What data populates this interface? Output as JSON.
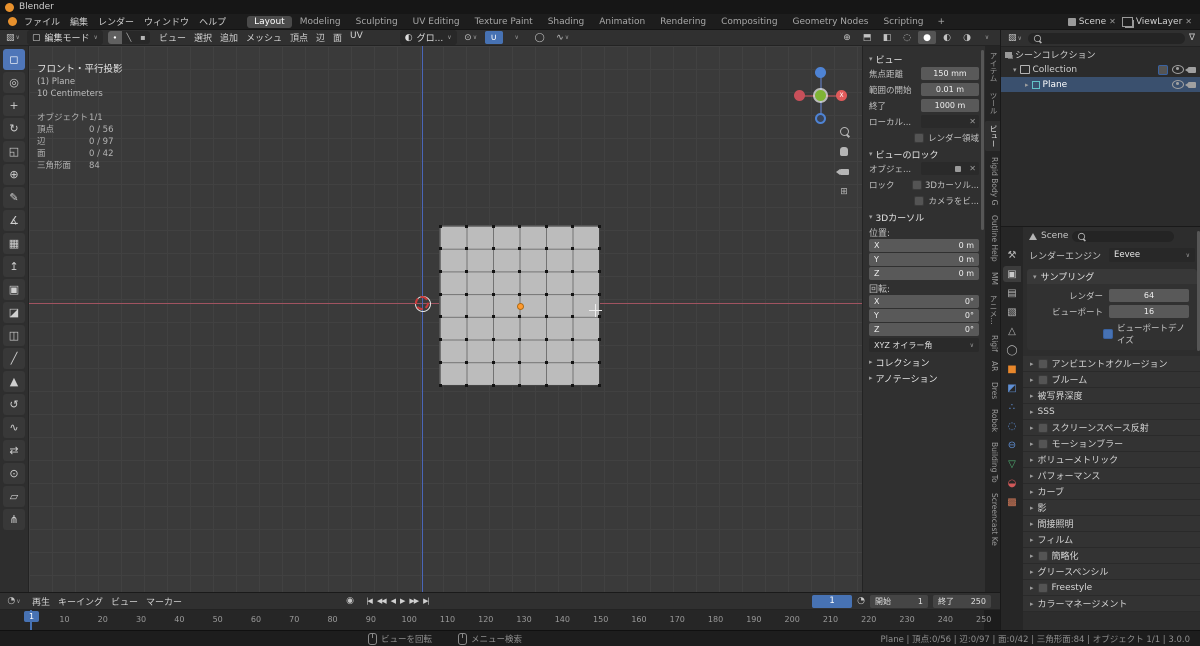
{
  "app": {
    "title": "Blender"
  },
  "colors": {
    "accent": "#4772b3",
    "object_orange": "#e8872b",
    "axis_x": "#a05360",
    "axis_z": "#4a66b8",
    "plane_fill": "#bcbcbc"
  },
  "icons": {
    "expanded": "▾",
    "collapsed": "▸",
    "dropdown": "∨",
    "close": "✕",
    "funnel": "∇",
    "grid": "⊞",
    "check": "✓",
    "globe": "◐",
    "pivot": "⊙",
    "magnet": "∪",
    "proportional": "◯",
    "falloff": "∿",
    "record": "◉",
    "clock": "◔",
    "editor_viewport": "▧",
    "editor_timeline": "◔",
    "edit_mode": "▢",
    "vertex_mode": "∙",
    "edge_mode": "╲",
    "face_mode": "▪",
    "ball_wire": "◌",
    "ball_solid": "●",
    "ball_material": "◐",
    "ball_rendered": "◑",
    "xray": "◧",
    "overlays": "⬒",
    "gizmos": "⊕"
  },
  "topbar": {
    "menus": [
      "ファイル",
      "編集",
      "レンダー",
      "ウィンドウ",
      "ヘルプ"
    ],
    "workspaces": [
      "Layout",
      "Modeling",
      "Sculpting",
      "UV Editing",
      "Texture Paint",
      "Shading",
      "Animation",
      "Rendering",
      "Compositing",
      "Geometry Nodes",
      "Scripting"
    ],
    "active_workspace": "Layout",
    "add_workspace_label": "+",
    "scene_label": "Scene",
    "view_layer_label": "ViewLayer"
  },
  "viewport_header": {
    "mode_label": "編集モード",
    "menus": [
      "ビュー",
      "選択",
      "追加",
      "メッシュ",
      "頂点",
      "辺",
      "面",
      "UV"
    ],
    "orientation_label": "グロ..."
  },
  "tools": [
    {
      "name": "select-box",
      "glyph": "◻",
      "active": true
    },
    {
      "name": "cursor",
      "glyph": "◎"
    },
    {
      "name": "move",
      "glyph": "+"
    },
    {
      "name": "rotate",
      "glyph": "↻"
    },
    {
      "name": "scale",
      "glyph": "◱"
    },
    {
      "name": "transform",
      "glyph": "⊕"
    },
    {
      "name": "annotate",
      "glyph": "✎"
    },
    {
      "name": "measure",
      "glyph": "∡"
    },
    {
      "name": "add-cube",
      "glyph": "▦"
    },
    {
      "name": "extrude",
      "glyph": "↥"
    },
    {
      "name": "inset-faces",
      "glyph": "▣"
    },
    {
      "name": "bevel",
      "glyph": "◪"
    },
    {
      "name": "loop-cut",
      "glyph": "◫"
    },
    {
      "name": "knife",
      "glyph": "╱"
    },
    {
      "name": "poly-build",
      "glyph": "▲"
    },
    {
      "name": "spin",
      "glyph": "↺"
    },
    {
      "name": "smooth",
      "glyph": "∿"
    },
    {
      "name": "edge-slide",
      "glyph": "⇄"
    },
    {
      "name": "shrink-fatten",
      "glyph": "⊙"
    },
    {
      "name": "shear",
      "glyph": "▱"
    },
    {
      "name": "rip-region",
      "glyph": "⋔"
    }
  ],
  "viewport": {
    "view_label": "フロント・平行投影",
    "object_label": "(1) Plane",
    "scale_label": "10 Centimeters",
    "stats": [
      {
        "label": "オブジェクト",
        "value": "1/1"
      },
      {
        "label": "頂点",
        "value": "0 / 56"
      },
      {
        "label": "辺",
        "value": "0 / 97"
      },
      {
        "label": "面",
        "value": "0 / 42"
      },
      {
        "label": "三角形面",
        "value": "84"
      }
    ],
    "gizmo_x_label": "X",
    "grid": {
      "cols": 6,
      "rows": 7
    }
  },
  "n_panel": {
    "tabs": [
      {
        "label": "アイテム"
      },
      {
        "label": "ツール"
      },
      {
        "label": "ビュー",
        "active": true
      },
      {
        "label": "Rigid Body G"
      },
      {
        "label": "Outline Help"
      },
      {
        "label": "MM"
      },
      {
        "label": "アニメ..."
      },
      {
        "label": "Rigif"
      },
      {
        "label": "AR"
      },
      {
        "label": "Dres"
      },
      {
        "label": "Robok"
      },
      {
        "label": "Building To"
      },
      {
        "label": "Screencast Ke"
      }
    ],
    "view": {
      "title": "ビュー",
      "focal_label": "焦点距離",
      "focal_value": "150 mm",
      "clip_start_label": "範囲の開始",
      "clip_start_value": "0.01 m",
      "clip_end_label": "終了",
      "clip_end_value": "1000 m",
      "local_camera_label": "ローカル...",
      "render_region_label": "レンダー領域"
    },
    "view_lock": {
      "title": "ビューのロック",
      "object_label": "オブジェ...",
      "lock_label": "ロック",
      "cursor_label": "3Dカーソル...",
      "camera_label": "カメラをビ..."
    },
    "cursor": {
      "title": "3Dカーソル",
      "location_label": "位置:",
      "location": [
        {
          "axis": "X",
          "value": "0 m"
        },
        {
          "axis": "Y",
          "value": "0 m"
        },
        {
          "axis": "Z",
          "value": "0 m"
        }
      ],
      "rotation_label": "回転:",
      "rotation": [
        {
          "axis": "X",
          "value": "0°"
        },
        {
          "axis": "Y",
          "value": "0°"
        },
        {
          "axis": "Z",
          "value": "0°"
        }
      ],
      "rotation_mode": "XYZ オイラー角"
    },
    "collections_title": "コレクション",
    "annotations_title": "アノテーション"
  },
  "outliner": {
    "rows": {
      "scene_collection": "シーンコレクション",
      "collection": "Collection",
      "object": "Plane"
    }
  },
  "properties": {
    "tabs": [
      {
        "name": "tool",
        "glyph": "⚒",
        "color": "#b8b8b8"
      },
      {
        "name": "render",
        "glyph": "▣",
        "color": "#c8c8c8",
        "active": true
      },
      {
        "name": "output",
        "glyph": "▤",
        "color": "#b8b8b8"
      },
      {
        "name": "view-layer",
        "glyph": "▧",
        "color": "#b8b8b8"
      },
      {
        "name": "scene",
        "glyph": "△",
        "color": "#b8b8b8"
      },
      {
        "name": "world",
        "glyph": "◯",
        "color": "#b8b8b8"
      },
      {
        "name": "object",
        "glyph": "■",
        "color": "#e8872b"
      },
      {
        "name": "modifiers",
        "glyph": "◩",
        "color": "#5f8fd4"
      },
      {
        "name": "particles",
        "glyph": "∴",
        "color": "#5f8fd4"
      },
      {
        "name": "physics",
        "glyph": "◌",
        "color": "#5f8fd4"
      },
      {
        "name": "constraints",
        "glyph": "⊖",
        "color": "#5f8fd4"
      },
      {
        "name": "object-data",
        "glyph": "▽",
        "color": "#4fae70"
      },
      {
        "name": "material",
        "glyph": "◒",
        "color": "#d05858"
      },
      {
        "name": "texture",
        "glyph": "▩",
        "color": "#d07858"
      }
    ],
    "breadcrumb": "Scene",
    "engine_label": "レンダーエンジン",
    "engine_value": "Eevee",
    "sampling": {
      "title": "サンプリング",
      "render_label": "レンダー",
      "render_value": "64",
      "viewport_label": "ビューポート",
      "viewport_value": "16",
      "denoise_label": "ビューポートデノイズ",
      "denoise_checked": true
    },
    "sections": [
      {
        "label": "アンビエントオクルージョン",
        "checkbox": true
      },
      {
        "label": "ブルーム",
        "checkbox": true
      },
      {
        "label": "被写界深度",
        "checkbox": false
      },
      {
        "label": "SSS",
        "checkbox": false
      },
      {
        "label": "スクリーンスペース反射",
        "checkbox": true
      },
      {
        "label": "モーションブラー",
        "checkbox": true
      },
      {
        "label": "ボリューメトリック",
        "checkbox": false
      },
      {
        "label": "パフォーマンス",
        "checkbox": false
      },
      {
        "label": "カーブ",
        "checkbox": false
      },
      {
        "label": "影",
        "checkbox": false
      },
      {
        "label": "間接照明",
        "checkbox": false
      },
      {
        "label": "フィルム",
        "checkbox": false
      },
      {
        "label": "簡略化",
        "checkbox": true
      },
      {
        "label": "グリースペンシル",
        "checkbox": false
      },
      {
        "label": "Freestyle",
        "checkbox": true
      },
      {
        "label": "カラーマネージメント",
        "checkbox": false
      }
    ]
  },
  "timeline": {
    "menus": [
      "再生",
      "キーイング",
      "ビュー",
      "マーカー"
    ],
    "playback": [
      "|◀",
      "◀◀",
      "◀",
      "▶",
      "▶▶",
      "▶|"
    ],
    "playback_names": [
      "jump-start",
      "prev-keyframe",
      "play-reverse",
      "play",
      "next-keyframe",
      "jump-end"
    ],
    "current_frame": "1",
    "start_label": "開始",
    "start_value": "1",
    "end_label": "終了",
    "end_value": "250",
    "ticks": [
      10,
      20,
      30,
      40,
      50,
      60,
      70,
      80,
      90,
      100,
      110,
      120,
      130,
      140,
      150,
      160,
      170,
      180,
      190,
      200,
      210,
      220,
      230,
      240,
      250
    ]
  },
  "statusbar": {
    "hints": [
      {
        "label": "ビューを回転"
      },
      {
        "label": "メニュー検索"
      }
    ],
    "stats": "Plane | 頂点:0/56 | 辺:0/97 | 面:0/42 | 三角形面:84 | オブジェクト 1/1 | 3.0.0"
  }
}
